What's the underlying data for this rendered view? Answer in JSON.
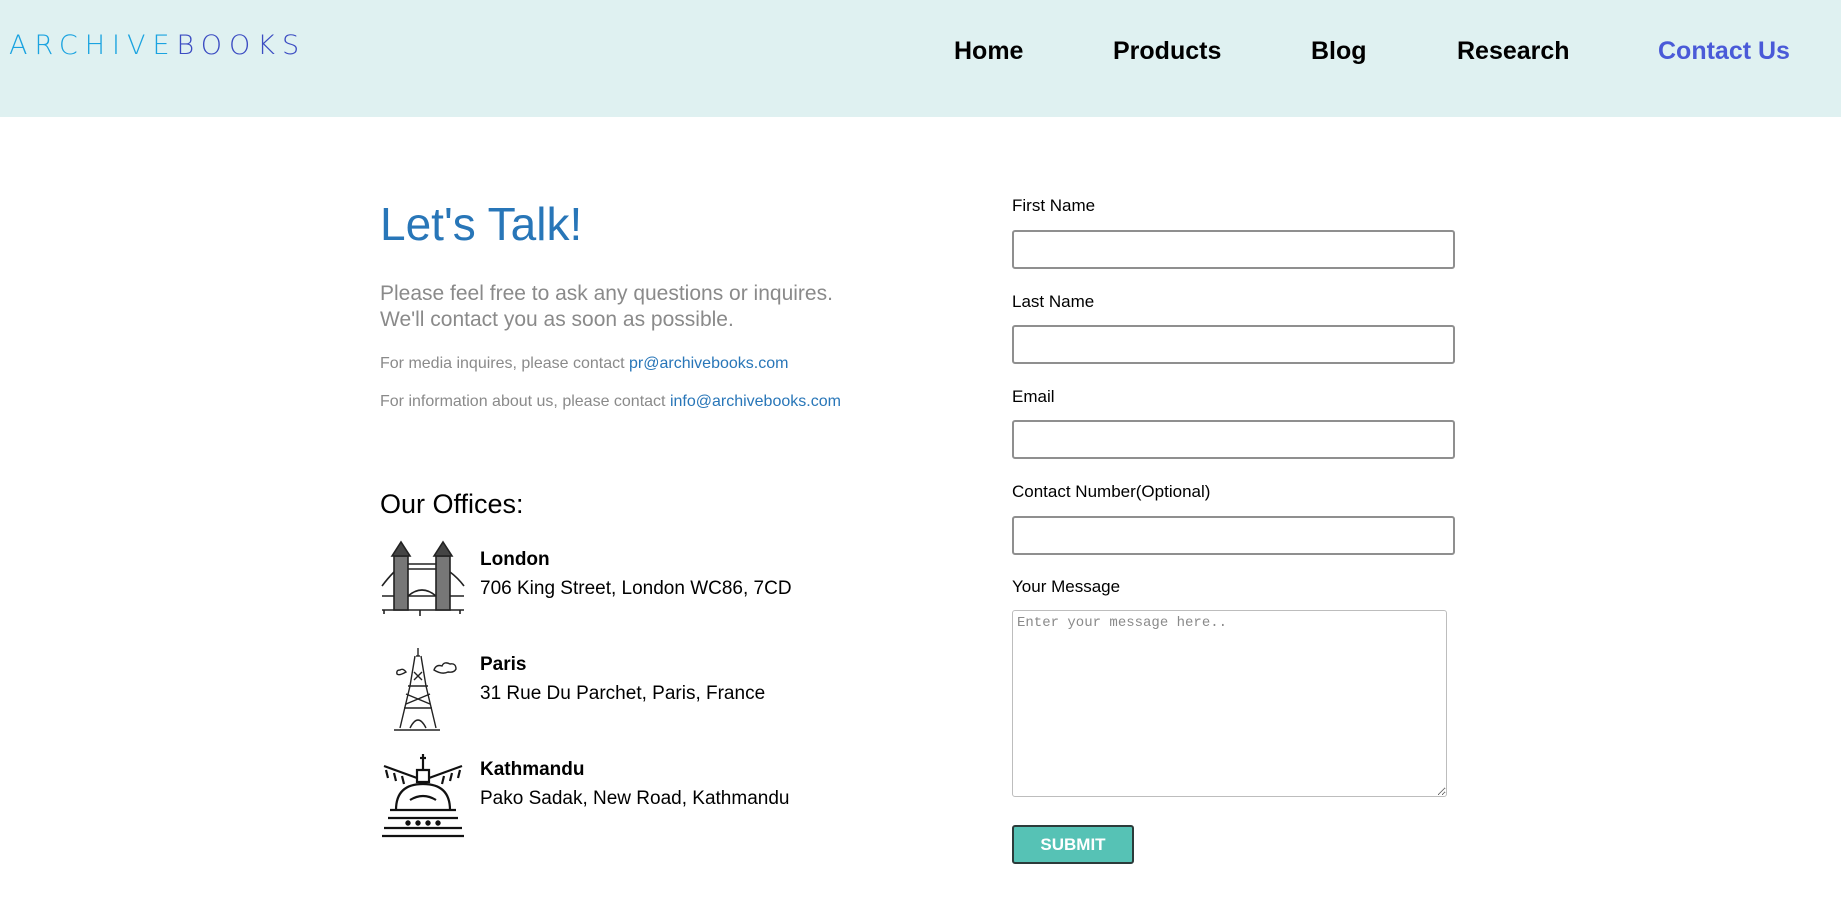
{
  "header": {
    "logo": {
      "part1": "ARCHIVE",
      "part2": "BOOKS"
    },
    "nav": [
      {
        "label": "Home",
        "color": "#000000"
      },
      {
        "label": "Products",
        "color": "#000000"
      },
      {
        "label": "Blog",
        "color": "#000000"
      },
      {
        "label": "Research",
        "color": "#000000"
      },
      {
        "label": "Contact Us",
        "color": "#4a5ad8",
        "active": true
      }
    ]
  },
  "intro": {
    "title": "Let's Talk!",
    "line1": "Please feel free to ask any questions or inquires.",
    "line2": "We'll contact you as soon as possible.",
    "media_prefix": "For media inquires, please contact ",
    "media_email": "pr@archivebooks.com",
    "info_prefix": "For information about us, please contact ",
    "info_email": "info@archivebooks.com"
  },
  "offices": {
    "title": "Our Offices:",
    "items": [
      {
        "city": "London",
        "address": "706 King Street, London WC86, 7CD",
        "icon": "tower-bridge-icon"
      },
      {
        "city": "Paris",
        "address": "31 Rue Du Parchet, Paris, France",
        "icon": "eiffel-tower-icon"
      },
      {
        "city": "Kathmandu",
        "address": "Pako Sadak, New Road, Kathmandu",
        "icon": "stupa-icon"
      }
    ]
  },
  "form": {
    "first_name_label": "First Name",
    "first_name_value": "",
    "last_name_label": "Last Name",
    "last_name_value": "",
    "email_label": "Email",
    "email_value": "",
    "phone_label": "Contact Number(Optional)",
    "phone_value": "",
    "message_label": "Your Message",
    "message_placeholder": "Enter your message here..",
    "submit_label": "SUBMIT"
  },
  "colors": {
    "header_bg": "#dff1f1",
    "accent": "#2876b8",
    "nav_active": "#4a5ad8",
    "submit_bg": "#56c2b5"
  }
}
